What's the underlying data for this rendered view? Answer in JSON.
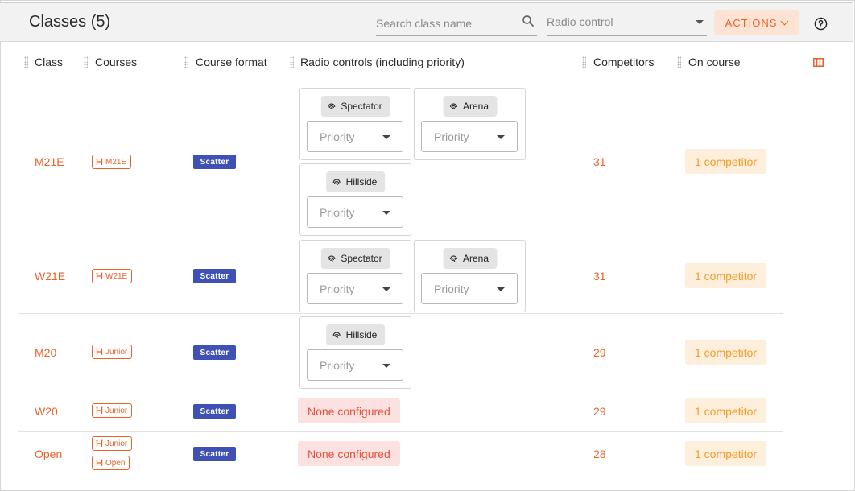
{
  "header": {
    "title": "Classes (5)",
    "search": {
      "placeholder": "Search class name",
      "value": ""
    },
    "radio_filter": {
      "placeholder": "Radio control"
    },
    "actions_label": "ACTIONS"
  },
  "columns": [
    "Class",
    "Courses",
    "Course format",
    "Radio controls (including priority)",
    "Competitors",
    "On course"
  ],
  "priority_placeholder": "Priority",
  "none_configured": "None configured",
  "colors": {
    "accent": "#e8622a",
    "format_badge": "#3f51b5",
    "none_bg": "#fde0e0",
    "oncourse_bg": "#fdefdc",
    "oncourse_text": "#f39c2a"
  },
  "rows": [
    {
      "class": "M21E",
      "courses": [
        "M21E"
      ],
      "format": "Scatter",
      "radio_controls": [
        "Spectator",
        "Arena",
        "Hillside"
      ],
      "competitors": "31",
      "on_course": "1 competitor"
    },
    {
      "class": "W21E",
      "courses": [
        "W21E"
      ],
      "format": "Scatter",
      "radio_controls": [
        "Spectator",
        "Arena"
      ],
      "competitors": "31",
      "on_course": "1 competitor"
    },
    {
      "class": "M20",
      "courses": [
        "Junior"
      ],
      "format": "Scatter",
      "radio_controls": [
        "Hillside"
      ],
      "competitors": "29",
      "on_course": "1 competitor"
    },
    {
      "class": "W20",
      "courses": [
        "Junior"
      ],
      "format": "Scatter",
      "radio_controls": [],
      "competitors": "29",
      "on_course": "1 competitor"
    },
    {
      "class": "Open",
      "courses": [
        "Junior",
        "Open"
      ],
      "format": "Scatter",
      "radio_controls": [],
      "competitors": "28",
      "on_course": "1 competitor"
    }
  ]
}
